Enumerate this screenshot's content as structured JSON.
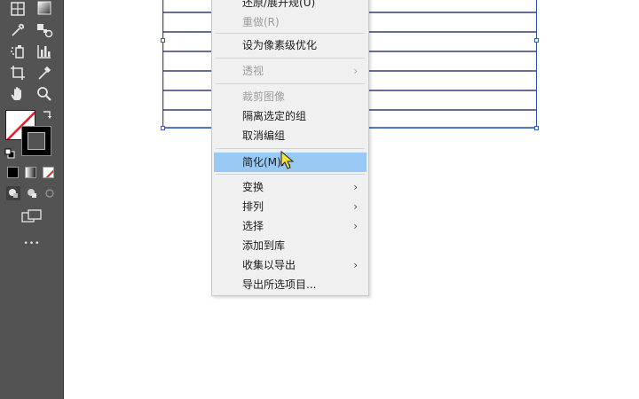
{
  "menu": {
    "items": [
      {
        "label": "还原/展开规(U)",
        "disabled": false
      },
      {
        "label": "重做(R)",
        "disabled": true
      },
      {
        "label": "设为像素级优化",
        "disabled": false
      },
      {
        "label": "透视",
        "disabled": true
      },
      {
        "label": "裁剪图像",
        "disabled": true
      },
      {
        "label": "隔离选定的组",
        "disabled": false
      },
      {
        "label": "取消编组",
        "disabled": false
      },
      {
        "label": "简化(M)...",
        "disabled": false,
        "highlighted": true
      },
      {
        "label": "变换",
        "disabled": false
      },
      {
        "label": "排列",
        "disabled": false
      },
      {
        "label": "选择",
        "disabled": false
      },
      {
        "label": "添加到库",
        "disabled": false
      },
      {
        "label": "收集以导出",
        "disabled": false
      },
      {
        "label": "导出所选项目...",
        "disabled": false
      }
    ],
    "submenu_arrow": "›"
  },
  "toolbar": {
    "more_label": "•••"
  },
  "colors": {
    "toolbar_bg": "#535353",
    "menu_bg": "#f0f0f0",
    "highlight": "#99c9f5",
    "artwork_stroke": "#1f2a6b",
    "selection": "#2e5fb7",
    "disabled_text": "#9c9c9c"
  }
}
